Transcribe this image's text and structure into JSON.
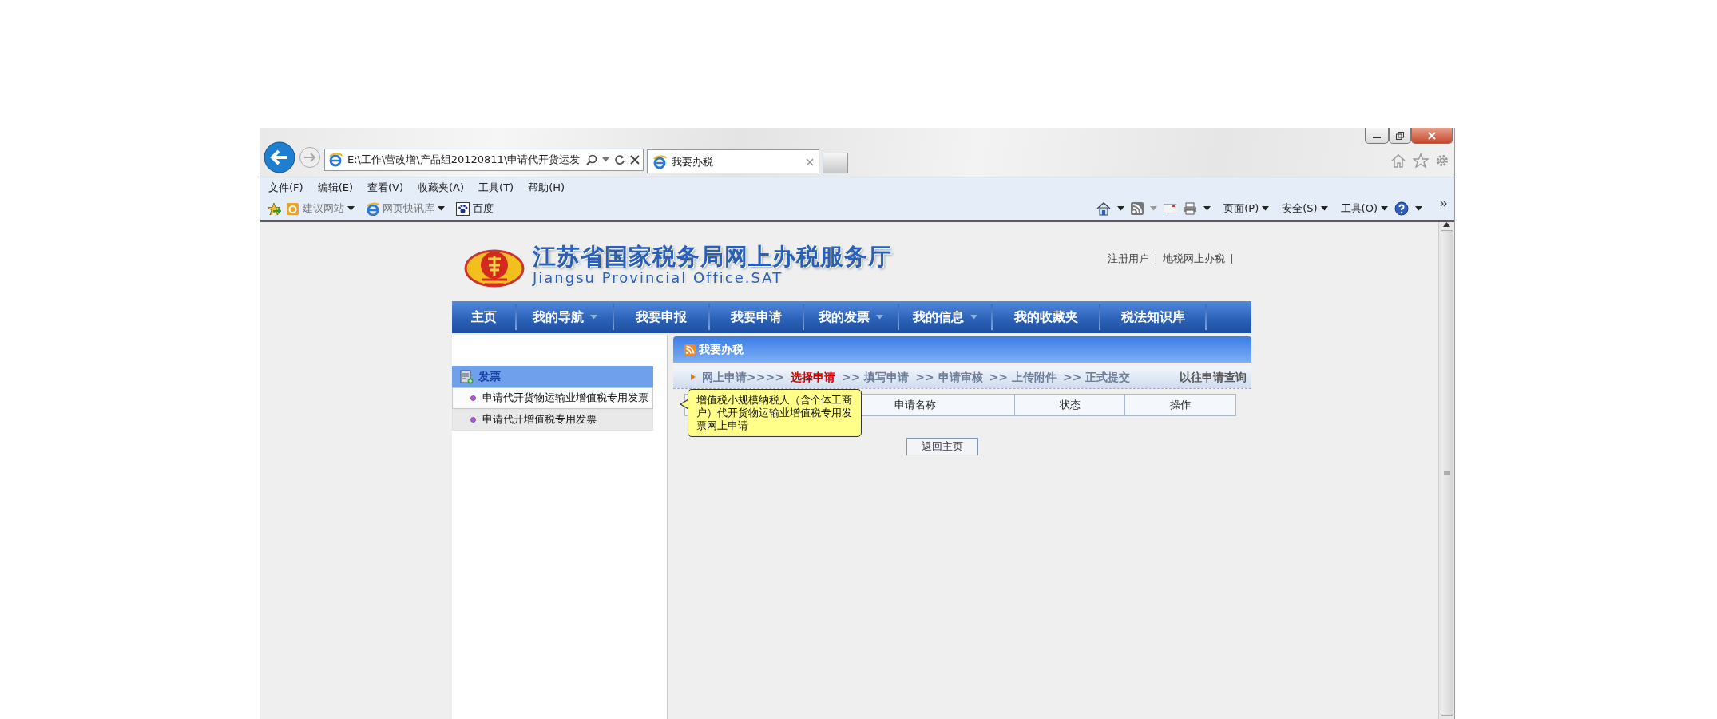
{
  "browser": {
    "address": "E:\\工作\\营改增\\产品组20120811\\申请代开货运发",
    "tabs": [
      {
        "title": "我要办税",
        "selected": true
      }
    ],
    "menu": [
      "文件(F)",
      "编辑(E)",
      "查看(V)",
      "收藏夹(A)",
      "工具(T)",
      "帮助(H)"
    ],
    "favorites": [
      {
        "label": "建议网站",
        "kind": "suggested",
        "dropdown": true
      },
      {
        "label": "网页快讯库",
        "kind": "webslice",
        "dropdown": true
      },
      {
        "label": "百度",
        "kind": "baidu",
        "dropdown": false
      }
    ],
    "commands": [
      "页面(P)",
      "安全(S)",
      "工具(O)"
    ]
  },
  "site": {
    "title": "江苏省国家税务局网上办税服务厅",
    "subtitle": "Jiangsu Provincial Office.SAT",
    "top_links": [
      "注册用户",
      "地税网上办税"
    ],
    "nav": [
      {
        "label": "主页",
        "dropdown": false
      },
      {
        "label": "我的导航",
        "dropdown": true
      },
      {
        "label": "我要申报",
        "dropdown": false
      },
      {
        "label": "我要申请",
        "dropdown": false
      },
      {
        "label": "我的发票",
        "dropdown": true
      },
      {
        "label": "我的信息",
        "dropdown": true
      },
      {
        "label": "我的收藏夹",
        "dropdown": false
      },
      {
        "label": "税法知识库",
        "dropdown": false
      }
    ]
  },
  "sidebar": {
    "heading": "发票",
    "items": [
      {
        "label": "申请代开货物运输业增值税专用发票",
        "hovered": true
      },
      {
        "label": "申请代开增值税专用发票",
        "hovered": false
      }
    ]
  },
  "panel": {
    "title": "我要办税",
    "steps": [
      {
        "text": "网上申请>>>>",
        "selected": false
      },
      {
        "text": "选择申请",
        "selected": true
      },
      {
        "text": ">> 填写申请",
        "selected": false
      },
      {
        "text": ">> 申请审核",
        "selected": false
      },
      {
        "text": ">> 上传附件",
        "selected": false
      },
      {
        "text": ">> 正式提交",
        "selected": false
      }
    ],
    "history_link": "以往申请查询",
    "columns": [
      "申请名称",
      "状态",
      "操作"
    ],
    "button": "返回主页"
  },
  "tooltip": {
    "text": "增值税小规模纳税人（含个体工商户）代开货物运输业增值税专用发票网上申请"
  }
}
